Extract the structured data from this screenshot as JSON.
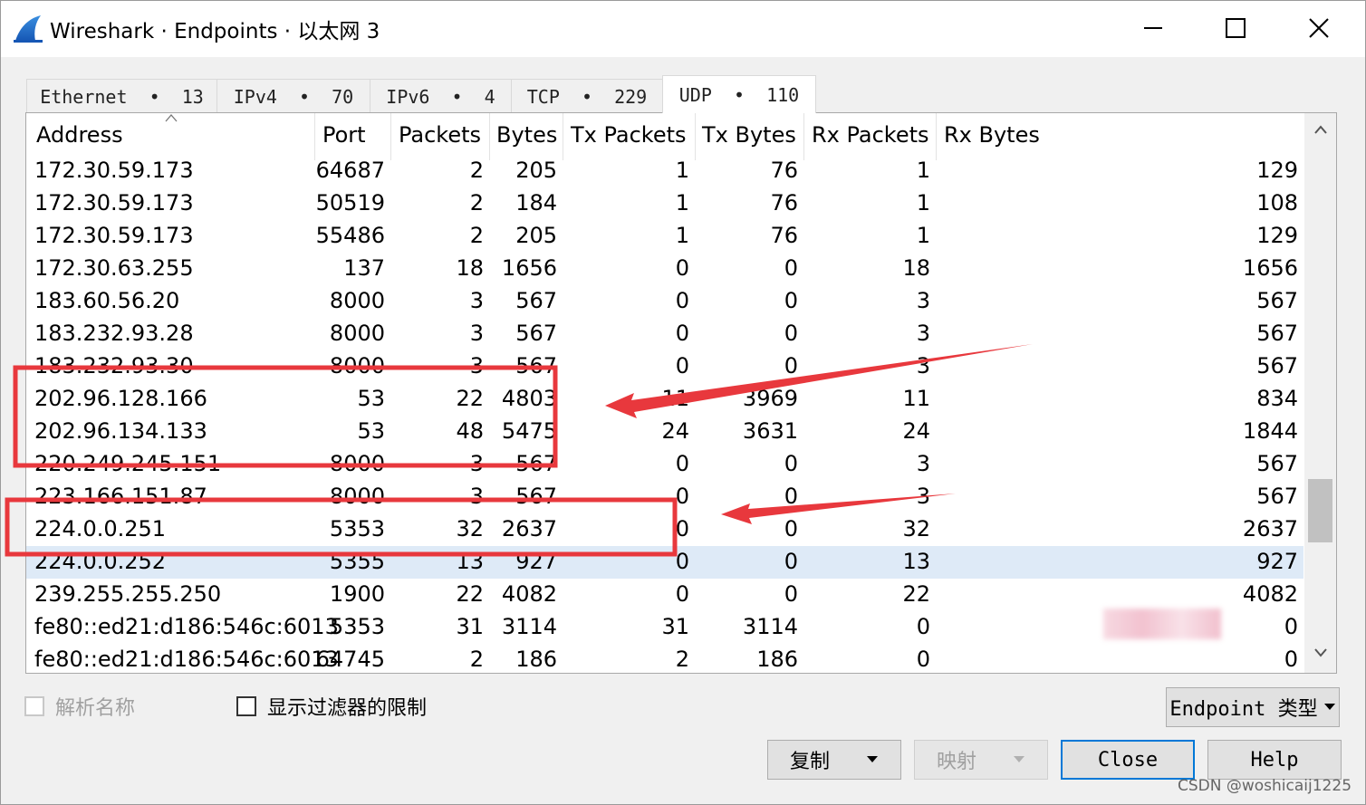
{
  "window": {
    "title": "Wireshark · Endpoints · 以太网 3"
  },
  "tabs": [
    {
      "label": "Ethernet  •  13"
    },
    {
      "label": "IPv4  •  70"
    },
    {
      "label": "IPv6  •  4"
    },
    {
      "label": "TCP  •  229"
    },
    {
      "label": "UDP  •  110",
      "active": true
    }
  ],
  "table": {
    "columns": [
      "Address",
      "Port",
      "Packets",
      "Bytes",
      "Tx Packets",
      "Tx Bytes",
      "Rx Packets",
      "Rx Bytes"
    ],
    "sort_column": "Address",
    "rows": [
      [
        "172.30.59.173",
        "64687",
        "2",
        "205",
        "1",
        "76",
        "1",
        "129"
      ],
      [
        "172.30.59.173",
        "50519",
        "2",
        "184",
        "1",
        "76",
        "1",
        "108"
      ],
      [
        "172.30.59.173",
        "55486",
        "2",
        "205",
        "1",
        "76",
        "1",
        "129"
      ],
      [
        "172.30.63.255",
        "137",
        "18",
        "1656",
        "0",
        "0",
        "18",
        "1656"
      ],
      [
        "183.60.56.20",
        "8000",
        "3",
        "567",
        "0",
        "0",
        "3",
        "567"
      ],
      [
        "183.232.93.28",
        "8000",
        "3",
        "567",
        "0",
        "0",
        "3",
        "567"
      ],
      [
        "183.232.93.30",
        "8000",
        "3",
        "567",
        "0",
        "0",
        "3",
        "567"
      ],
      [
        "202.96.128.166",
        "53",
        "22",
        "4803",
        "11",
        "3969",
        "11",
        "834"
      ],
      [
        "202.96.134.133",
        "53",
        "48",
        "5475",
        "24",
        "3631",
        "24",
        "1844"
      ],
      [
        "220.249.245.151",
        "8000",
        "3",
        "567",
        "0",
        "0",
        "3",
        "567"
      ],
      [
        "223.166.151.87",
        "8000",
        "3",
        "567",
        "0",
        "0",
        "3",
        "567"
      ],
      [
        "224.0.0.251",
        "5353",
        "32",
        "2637",
        "0",
        "0",
        "32",
        "2637"
      ],
      [
        "224.0.0.252",
        "5355",
        "13",
        "927",
        "0",
        "0",
        "13",
        "927"
      ],
      [
        "239.255.255.250",
        "1900",
        "22",
        "4082",
        "0",
        "0",
        "22",
        "4082"
      ],
      [
        "fe80::ed21:d186:546c:6013",
        "5353",
        "31",
        "3114",
        "31",
        "3114",
        "0",
        "0"
      ],
      [
        "fe80::ed21:d186:546c:6013",
        "64745",
        "2",
        "186",
        "2",
        "186",
        "0",
        "0"
      ]
    ],
    "selected_row_index": 12,
    "scroll_position_fraction": 0.78
  },
  "options": {
    "resolve_names_label": "解析名称",
    "resolve_names_checked": false,
    "resolve_names_enabled": false,
    "limit_to_filter_label": "显示过滤器的限制",
    "limit_to_filter_checked": false
  },
  "buttons": {
    "endpoint_type": "Endpoint 类型",
    "copy": "复制",
    "map": "映射",
    "close": "Close",
    "help": "Help"
  },
  "watermark": "CSDN @woshicaij1225",
  "colors": {
    "annotation_red": "#e8383d",
    "selected_row": "#deeaf7",
    "focus_blue": "#0078d7"
  },
  "icons": [
    "wireshark-fin-icon",
    "minimize-icon",
    "maximize-icon",
    "close-icon",
    "sort-caret-icon",
    "scroll-up-icon",
    "scroll-down-icon",
    "dropdown-arrow-icon"
  ]
}
